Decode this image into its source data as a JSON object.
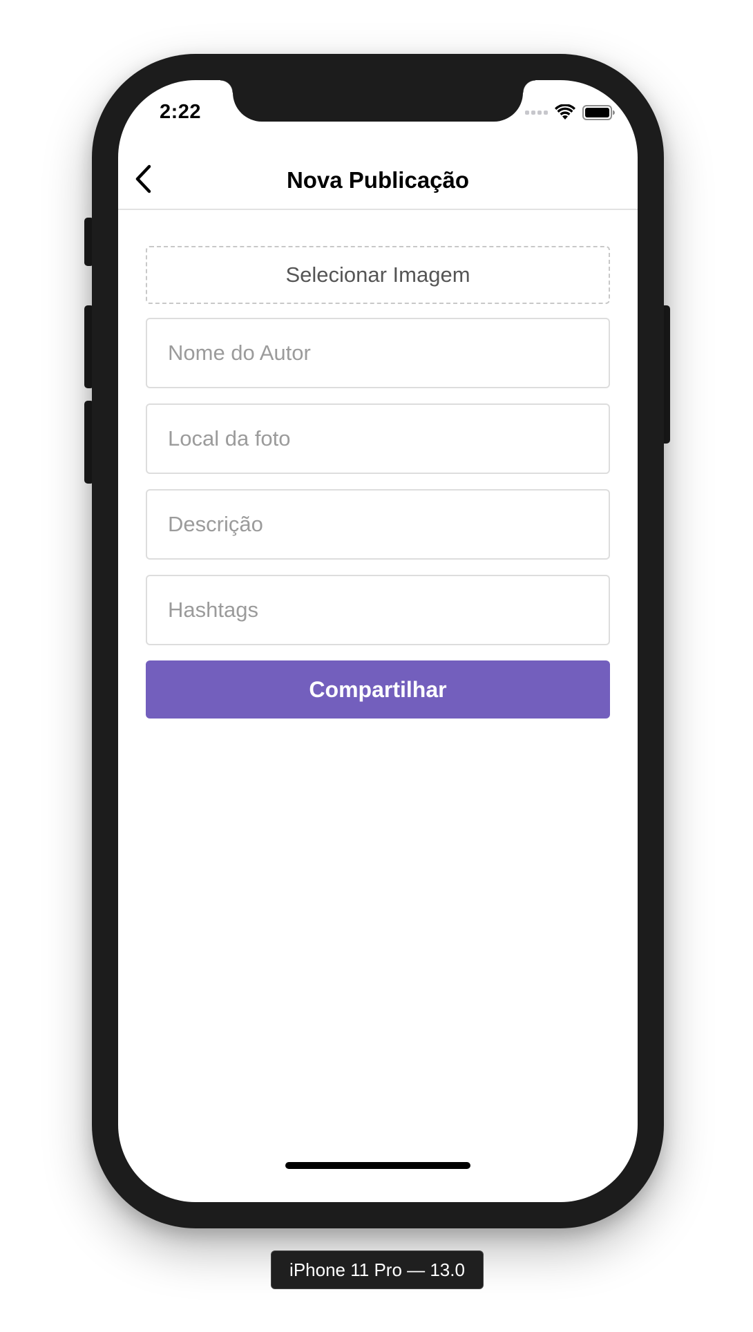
{
  "status_bar": {
    "time": "2:22"
  },
  "navbar": {
    "title": "Nova Publicação",
    "back_icon": "chevron-left-icon"
  },
  "form": {
    "select_image_label": "Selecionar Imagem",
    "author_placeholder": "Nome do Autor",
    "author_value": "",
    "location_placeholder": "Local da foto",
    "location_value": "",
    "description_placeholder": "Descrição",
    "description_value": "",
    "hashtags_placeholder": "Hashtags",
    "hashtags_value": "",
    "share_label": "Compartilhar"
  },
  "simulator": {
    "device_label": "iPhone 11 Pro — 13.0"
  },
  "colors": {
    "accent": "#735fbd",
    "frame": "#1c1c1c"
  }
}
